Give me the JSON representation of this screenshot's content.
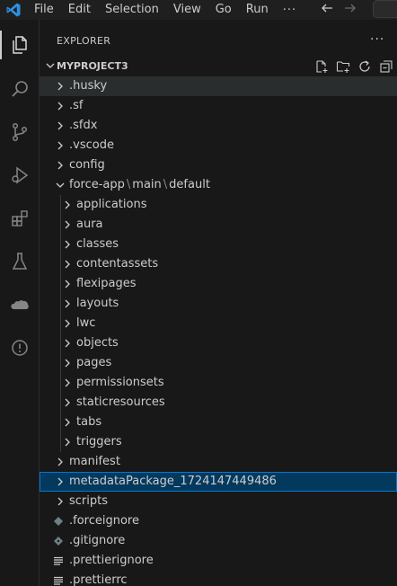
{
  "titlebar": {
    "menu": [
      "File",
      "Edit",
      "Selection",
      "View",
      "Go",
      "Run"
    ],
    "more": "···",
    "back_icon": "arrow-left-icon",
    "forward_icon": "arrow-right-icon"
  },
  "activitybar": {
    "items": [
      "explorer-icon",
      "search-icon",
      "source-control-icon",
      "run-debug-icon",
      "extensions-icon",
      "testing-icon",
      "salesforce-icon",
      "problems-icon"
    ]
  },
  "sidebar": {
    "title": "EXPLORER",
    "more": "···",
    "section": {
      "title": "MYPROJECT3",
      "actions": [
        "new-file-icon",
        "new-folder-icon",
        "refresh-icon",
        "collapse-all-icon"
      ]
    }
  },
  "tree": [
    {
      "name": ".husky",
      "type": "folder",
      "depth": 0,
      "state": "hover"
    },
    {
      "name": ".sf",
      "type": "folder",
      "depth": 0
    },
    {
      "name": ".sfdx",
      "type": "folder",
      "depth": 0
    },
    {
      "name": ".vscode",
      "type": "folder",
      "depth": 0
    },
    {
      "name": "config",
      "type": "folder",
      "depth": 0
    },
    {
      "name_parts": [
        "force-app",
        "main",
        "default"
      ],
      "separator": "\\",
      "type": "folder",
      "depth": 0,
      "expanded": true
    },
    {
      "name": "applications",
      "type": "folder",
      "depth": 1
    },
    {
      "name": "aura",
      "type": "folder",
      "depth": 1
    },
    {
      "name": "classes",
      "type": "folder",
      "depth": 1
    },
    {
      "name": "contentassets",
      "type": "folder",
      "depth": 1
    },
    {
      "name": "flexipages",
      "type": "folder",
      "depth": 1
    },
    {
      "name": "layouts",
      "type": "folder",
      "depth": 1
    },
    {
      "name": "lwc",
      "type": "folder",
      "depth": 1
    },
    {
      "name": "objects",
      "type": "folder",
      "depth": 1
    },
    {
      "name": "pages",
      "type": "folder",
      "depth": 1
    },
    {
      "name": "permissionsets",
      "type": "folder",
      "depth": 1
    },
    {
      "name": "staticresources",
      "type": "folder",
      "depth": 1
    },
    {
      "name": "tabs",
      "type": "folder",
      "depth": 1
    },
    {
      "name": "triggers",
      "type": "folder",
      "depth": 1
    },
    {
      "name": "manifest",
      "type": "folder",
      "depth": 0
    },
    {
      "name": "metadataPackage_1724147449486",
      "type": "folder",
      "depth": 0,
      "state": "selected"
    },
    {
      "name": "scripts",
      "type": "folder",
      "depth": 0
    },
    {
      "name": ".forceignore",
      "type": "file",
      "icon": "diamond-file-icon",
      "depth": 0
    },
    {
      "name": ".gitignore",
      "type": "file",
      "icon": "git-file-icon",
      "depth": 0
    },
    {
      "name": ".prettierignore",
      "type": "file",
      "icon": "lines-file-icon",
      "depth": 0
    },
    {
      "name": ".prettierrc",
      "type": "file",
      "icon": "lines-file-icon",
      "depth": 0
    }
  ]
}
